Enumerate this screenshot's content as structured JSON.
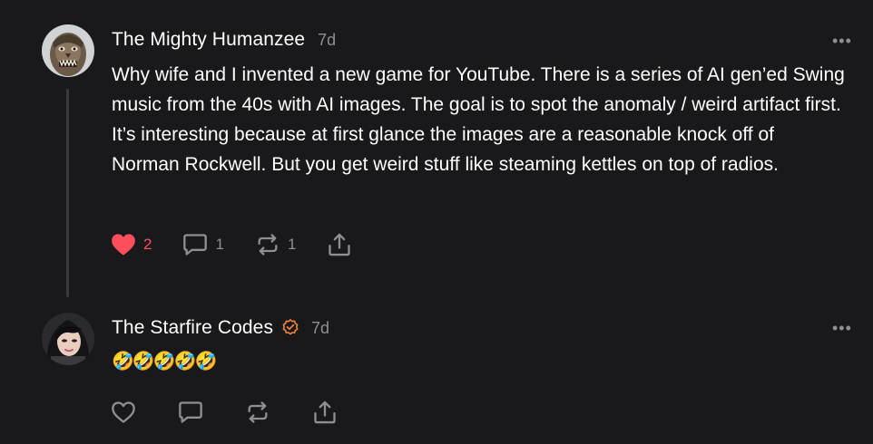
{
  "posts": [
    {
      "author": "The Mighty Humanzee",
      "timestamp": "7d",
      "text": "Why wife and I invented a new game for YouTube. There is a series of AI gen’ed Swing music from the 40s with AI images. The goal is to spot the anomaly / weird artifact first. It’s interesting because at first glance the images are a reasonable knock off of Norman Rockwell. But you get weird stuff like steaming kettles on top of radios.",
      "likes": "2",
      "replies": "1",
      "reposts": "1",
      "liked": true,
      "verified": false
    },
    {
      "author": "The Starfire Codes",
      "timestamp": "7d",
      "text": "🤣🤣🤣🤣🤣",
      "likes": "",
      "replies": "",
      "reposts": "",
      "liked": false,
      "verified": true
    }
  ],
  "icons": {
    "more": "more-horizontal-icon",
    "like": "heart-icon",
    "reply": "comment-bubble-icon",
    "repost": "repost-arrows-icon",
    "share": "share-upload-icon",
    "verified": "verified-check-badge-icon"
  },
  "colors": {
    "background": "#19191b",
    "text": "#ffffff",
    "muted": "#8e8e93",
    "like": "#ff4e5b",
    "verified": "#f0843c",
    "thread_line": "#3a3a3d"
  }
}
